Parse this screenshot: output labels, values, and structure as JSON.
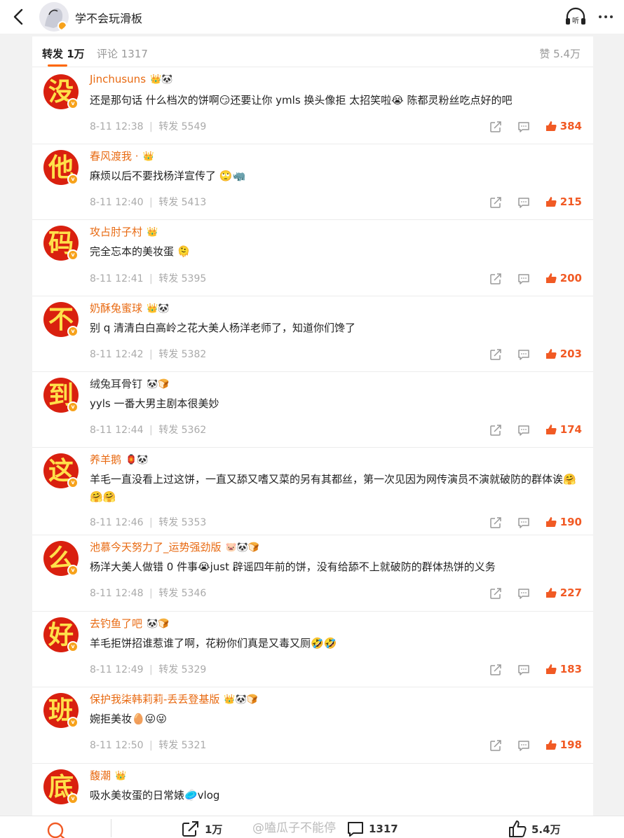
{
  "header": {
    "title": "学不会玩滑板",
    "listen_label": "听"
  },
  "tabs": {
    "repost": "转发 1万",
    "comment": "评论 1317",
    "like": "赞 5.4万"
  },
  "comments": [
    {
      "avatar_char": "没",
      "name": "Jinchusuns",
      "badges": "👑🐼",
      "text": "还是那句话 什么档次的饼啊😏还要让你 ymls 换头像拒 太招笑啦😭 陈都灵粉丝吃点好的吧",
      "time": "8-11 12:38",
      "repost": "转发 5549",
      "likes": "384"
    },
    {
      "avatar_char": "他",
      "name": "春风渡我 ·",
      "badges": "👑",
      "text": "麻烦以后不要找杨洋宣传了 🙄🦏",
      "time": "8-11 12:40",
      "repost": "转发 5413",
      "likes": "215"
    },
    {
      "avatar_char": "码",
      "name": "攻占肘子村",
      "badges": "👑",
      "text": "完全忘本的美妆蛋 🫠",
      "time": "8-11 12:41",
      "repost": "转发 5395",
      "likes": "200"
    },
    {
      "avatar_char": "不",
      "name": "奶酥兔蜜球",
      "badges": "👑🐼",
      "text": "别 q 清清白白高岭之花大美人杨洋老师了，知道你们馋了",
      "time": "8-11 12:42",
      "repost": "转发 5382",
      "likes": "203"
    },
    {
      "avatar_char": "到",
      "name": "绒兔耳骨钉",
      "badges": "🐼🍞",
      "text": "yyls 一番大男主剧本很美妙",
      "time": "8-11 12:44",
      "repost": "转发 5362",
      "likes": "174"
    },
    {
      "avatar_char": "这",
      "name": "养羊鹅",
      "badges": "🏮🐼",
      "text": "羊毛一直没看上过这饼，一直又舔又嗜又菜的另有其都丝，第一次见因为网传演员不演就破防的群体诶🤗🤗🤗",
      "time": "8-11 12:46",
      "repost": "转发 5353",
      "likes": "190"
    },
    {
      "avatar_char": "么",
      "name": "池慕今天努力了_运势强劲版",
      "badges": "🐷🐼🍞",
      "text": "杨洋大美人做错 0 件事😭just 辟谣四年前的饼，没有给舔不上就破防的群体热饼的义务",
      "time": "8-11 12:48",
      "repost": "转发 5346",
      "likes": "227"
    },
    {
      "avatar_char": "好",
      "name": "去钓鱼了吧",
      "badges": "🐼🍞",
      "text": "羊毛拒饼招谁惹谁了啊，花粉你们真是又毒又厕🤣🤣",
      "time": "8-11 12:49",
      "repost": "转发 5329",
      "likes": "183"
    },
    {
      "avatar_char": "班",
      "name": "保护我柒韩莉莉-丢丢登基版",
      "badges": "👑🐼🍞",
      "text": "婉拒美妆🥚😜😜",
      "time": "8-11 12:50",
      "repost": "转发 5321",
      "likes": "198"
    },
    {
      "avatar_char": "底",
      "name": "馥潮",
      "badges": "👑",
      "text": "吸水美妆蛋的日常婊🥏vlog",
      "time": "",
      "repost": "",
      "likes": ""
    }
  ],
  "bottom": {
    "repost": "1万",
    "comment": "1317",
    "like": "5.4万",
    "watermark": "@嗑瓜子不能停"
  },
  "colors": {
    "accent": "#f15a24",
    "username": "#e86a12",
    "avatar_bg": "#d9200f",
    "avatar_text": "#ffe14a"
  }
}
